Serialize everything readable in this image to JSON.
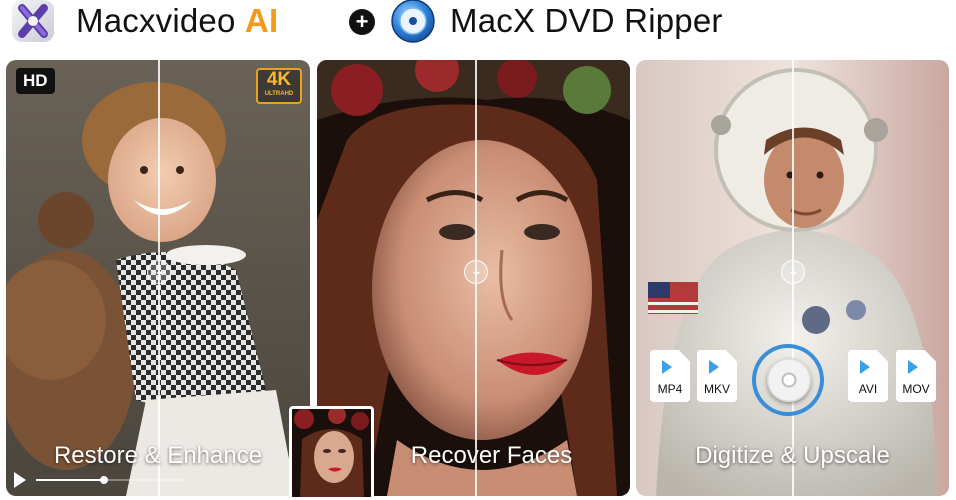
{
  "header": {
    "title_part1": "Macxvideo ",
    "title_ai": "AI",
    "plus_symbol": "+",
    "title_part2": "MacX DVD Ripper",
    "icons": [
      "macxvideo-ai-app-icon",
      "macx-dvd-ripper-app-icon",
      "plus-icon"
    ]
  },
  "panels": [
    {
      "caption": "Restore & Enhance",
      "badge_left": "HD",
      "badge_right_big": "4K",
      "badge_right_small": "ULTRAHD",
      "player_progress": 0.45
    },
    {
      "caption": "Recover Faces"
    },
    {
      "caption": "Digitize & Upscale",
      "formats": [
        "MP4",
        "MKV",
        "AVI",
        "MOV"
      ]
    }
  ],
  "colors": {
    "ai_accent": "#f39a1d",
    "badge_4k": "#e8a21d",
    "format_play": "#3aa0e8",
    "convert_arrows": "#3a8ed8"
  }
}
